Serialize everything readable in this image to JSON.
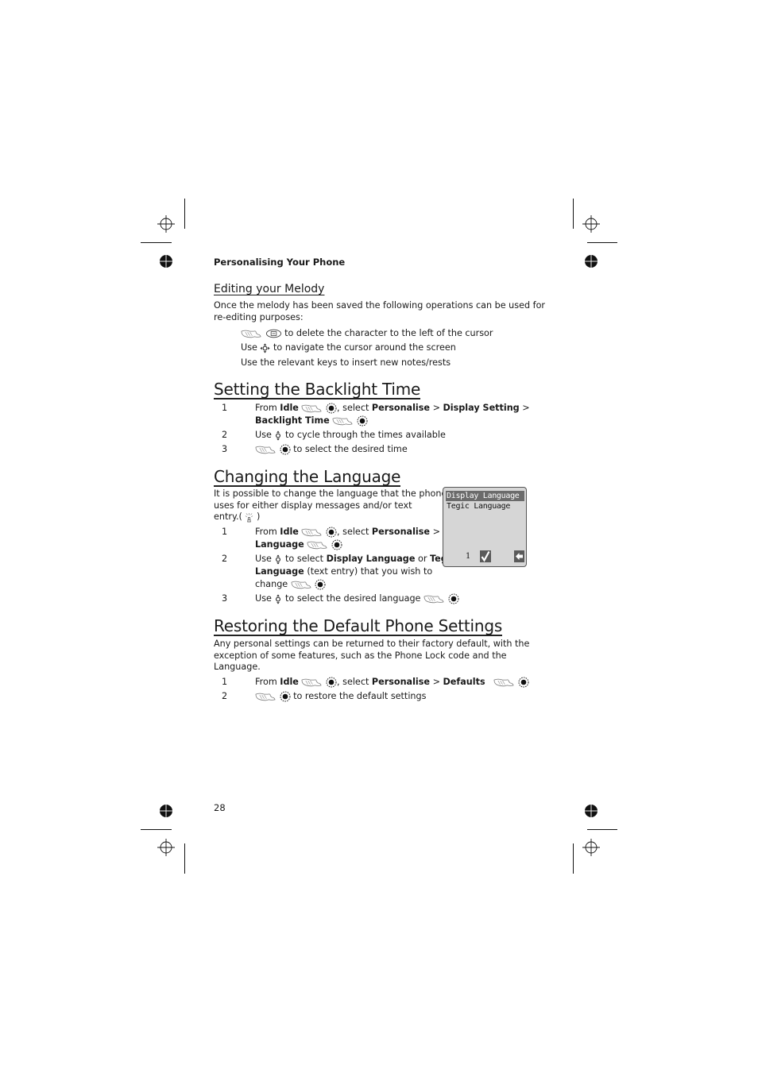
{
  "page": {
    "running_head": "Personalising Your Phone",
    "page_number": "28"
  },
  "melody": {
    "heading": "Editing your Melody",
    "intro_line1": "Once the melody has been saved the following operations can be used for",
    "intro_line2": "re-editing purposes:",
    "op1": "to delete the character to the left of the cursor",
    "op2_use": "Use",
    "op2": "to navigate the cursor around the screen",
    "op3": "Use the relevant keys to insert new notes/rests"
  },
  "backlight": {
    "heading": "Setting the Backlight Time",
    "steps": [
      {
        "num": "1",
        "from": "From",
        "idle": "Idle",
        "select": ", select",
        "personalise": "Personalise",
        "gt1": ">",
        "display_setting": "Display Setting",
        "gt2": ">",
        "backlight_time": "Backlight Time"
      },
      {
        "num": "2",
        "use": "Use",
        "text": "to cycle through the times available"
      },
      {
        "num": "3",
        "text": "to select the desired time"
      }
    ]
  },
  "language": {
    "heading": "Changing the Language",
    "intro_line1": "It is possible to change the language that the phone",
    "intro_line2": "uses for either display messages and/or text",
    "intro_line3_a": "entry.(",
    "intro_line3_b": ")",
    "steps": [
      {
        "num": "1",
        "from": "From",
        "idle": "Idle",
        "select": ", select",
        "personalise": "Personalise",
        "gt": ">",
        "language": "Language"
      },
      {
        "num": "2",
        "use": "Use",
        "to_select": "to select",
        "display_language": "Display Language",
        "or": "or",
        "tegic": "Tegic",
        "language": "Language",
        "rest": "(text entry) that you wish to",
        "change": "change"
      },
      {
        "num": "3",
        "use": "Use",
        "text": "to select the desired language"
      }
    ],
    "screen": {
      "items": [
        "Display Language",
        "Tegic Language"
      ],
      "selected_index": 0,
      "page_indicator": "1",
      "left_softkey_icon": "checkmark-icon",
      "right_softkey_icon": "back-arrow-icon"
    }
  },
  "defaults": {
    "heading": "Restoring the Default Phone Settings",
    "intro_line1": "Any personal settings can be returned to their factory default, with the",
    "intro_line2": "exception of some features, such as the Phone Lock code and the",
    "intro_line3": "Language.",
    "steps": [
      {
        "num": "1",
        "from": "From",
        "idle": "Idle",
        "select": ", select",
        "personalise": "Personalise",
        "gt": ">",
        "defaults": "Defaults"
      },
      {
        "num": "2",
        "text": "to restore the default settings"
      }
    ]
  },
  "icons": {
    "press": "finger-press-icon",
    "select_key": "select-key-icon",
    "clear_key": "clear-key-icon",
    "nav_4way": "four-way-navigation-icon",
    "nav_updown": "up-down-navigation-icon",
    "tip": "tip-icon"
  }
}
